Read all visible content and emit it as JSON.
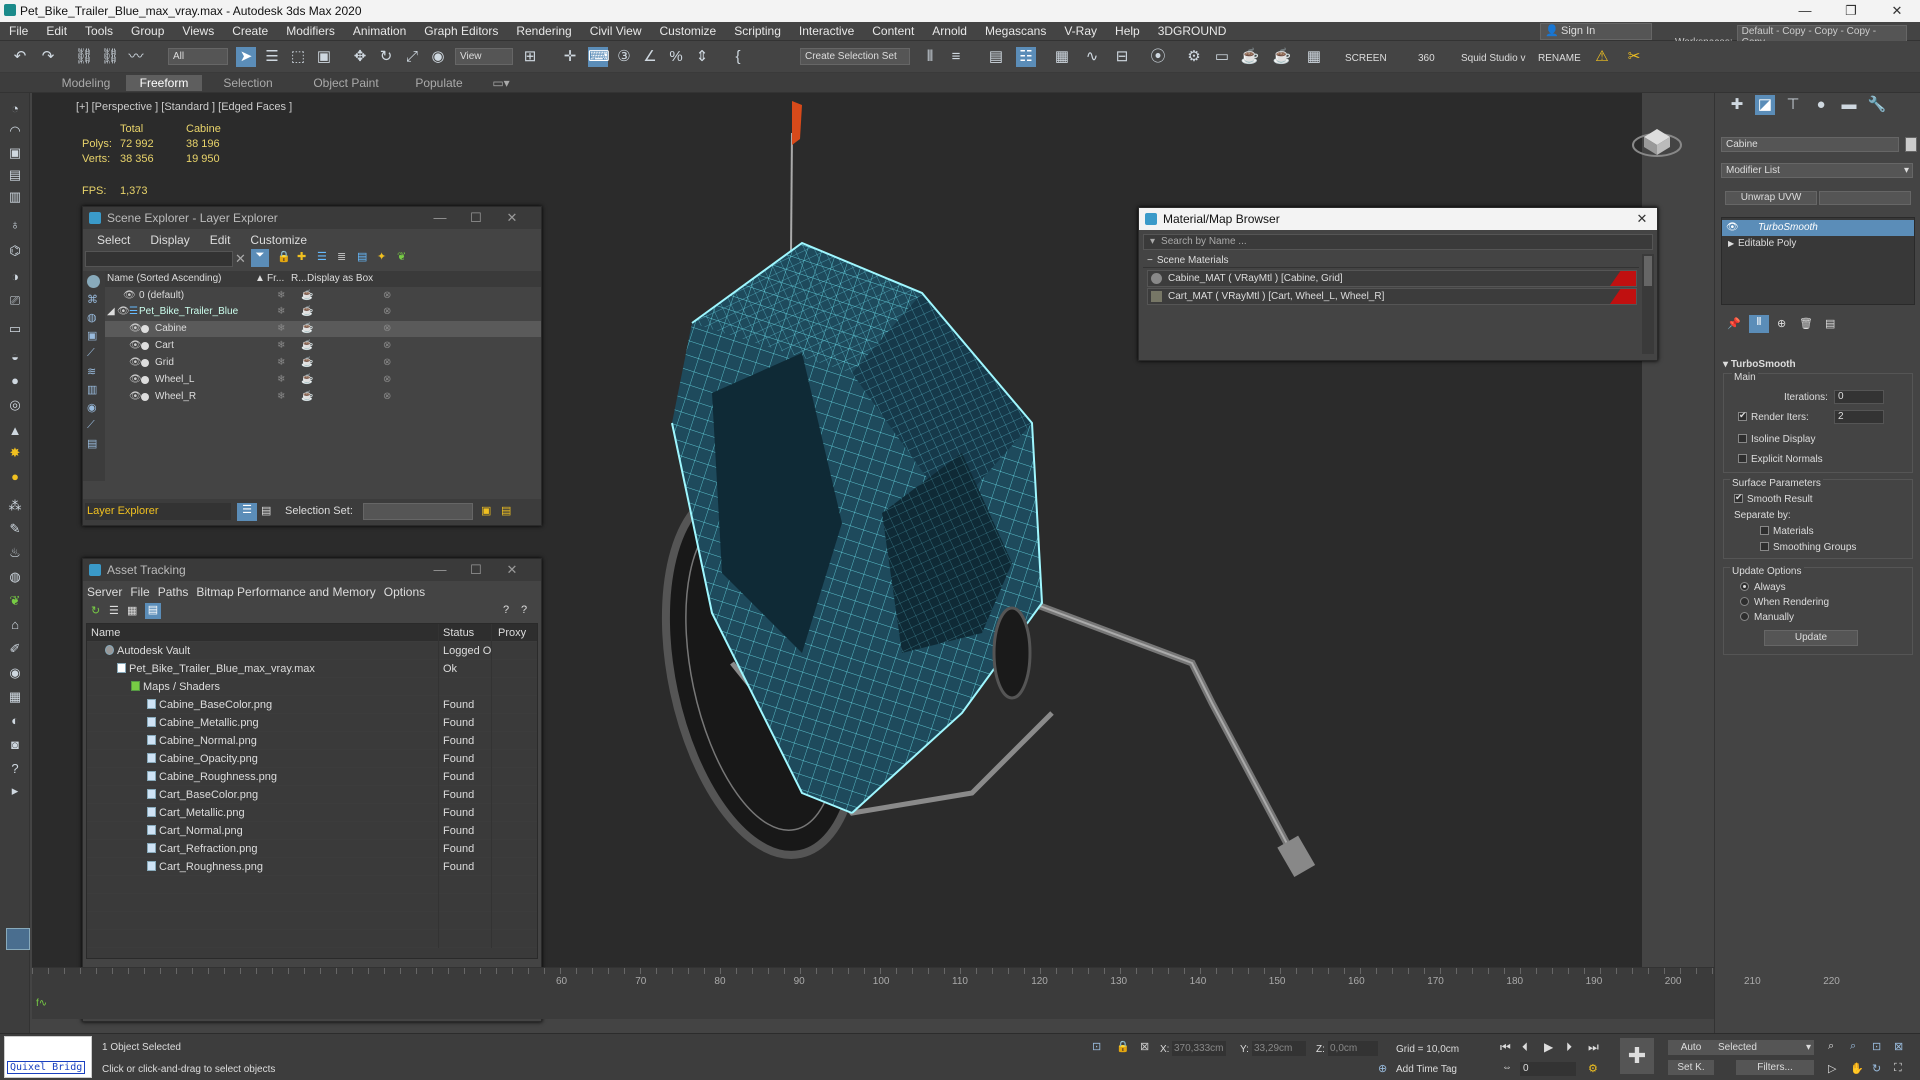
{
  "app": {
    "title": "Pet_Bike_Trailer_Blue_max_vray.max - Autodesk 3ds Max 2020"
  },
  "menu": [
    "File",
    "Edit",
    "Tools",
    "Group",
    "Views",
    "Create",
    "Modifiers",
    "Animation",
    "Graph Editors",
    "Rendering",
    "Civil View",
    "Customize",
    "Scripting",
    "Interactive",
    "Content",
    "Arnold",
    "Megascans",
    "V-Ray",
    "Help",
    "3DGROUND"
  ],
  "account": {
    "signin": "Sign In",
    "workspaces_label": "Workspaces:",
    "workspace_value": "Default - Copy - Copy - Copy - Copy"
  },
  "toolbar": {
    "filter": "All",
    "view": "View",
    "selection_set": "Create Selection Set",
    "screen": "SCREEN",
    "num360": "360",
    "squid": "Squid Studio v",
    "rename": "RENAME"
  },
  "ribbon": {
    "tabs": [
      "Modeling",
      "Freeform",
      "Selection",
      "Object Paint",
      "Populate"
    ],
    "active": "Freeform"
  },
  "viewport": {
    "label": "[+] [Perspective ] [Standard ] [Edged Faces ]",
    "stats": {
      "total_label": "Total",
      "obj_label": "Cabine",
      "polys_label": "Polys:",
      "polys_total": "72 992",
      "polys_obj": "38 196",
      "verts_label": "Verts:",
      "verts_total": "38 356",
      "verts_obj": "19 950",
      "fps_label": "FPS:",
      "fps": "1,373"
    }
  },
  "scene_explorer": {
    "title": "Scene Explorer - Layer Explorer",
    "menu": [
      "Select",
      "Display",
      "Edit",
      "Customize"
    ],
    "columns": {
      "name": "Name (Sorted Ascending)",
      "fr": "Fr...",
      "r": "R...",
      "box": "Display as Box"
    },
    "rows": [
      {
        "label": "0 (default)"
      },
      {
        "label": "Pet_Bike_Trailer_Blue"
      },
      {
        "label": "Cabine"
      },
      {
        "label": "Cart"
      },
      {
        "label": "Grid"
      },
      {
        "label": "Wheel_L"
      },
      {
        "label": "Wheel_R"
      }
    ],
    "footer_layer": "Layer Explorer",
    "footer_selset": "Selection Set:"
  },
  "asset_tracking": {
    "title": "Asset Tracking",
    "menu": [
      "Server",
      "File",
      "Paths",
      "Bitmap Performance and Memory",
      "Options"
    ],
    "columns": {
      "name": "Name",
      "status": "Status",
      "proxy": "Proxy"
    },
    "rows": [
      {
        "name": "Autodesk Vault",
        "status": "Logged O..."
      },
      {
        "name": "Pet_Bike_Trailer_Blue_max_vray.max",
        "status": "Ok"
      },
      {
        "name": "Maps / Shaders",
        "status": ""
      },
      {
        "name": "Cabine_BaseColor.png",
        "status": "Found"
      },
      {
        "name": "Cabine_Metallic.png",
        "status": "Found"
      },
      {
        "name": "Cabine_Normal.png",
        "status": "Found"
      },
      {
        "name": "Cabine_Opacity.png",
        "status": "Found"
      },
      {
        "name": "Cabine_Roughness.png",
        "status": "Found"
      },
      {
        "name": "Cart_BaseColor.png",
        "status": "Found"
      },
      {
        "name": "Cart_Metallic.png",
        "status": "Found"
      },
      {
        "name": "Cart_Normal.png",
        "status": "Found"
      },
      {
        "name": "Cart_Refraction.png",
        "status": "Found"
      },
      {
        "name": "Cart_Roughness.png",
        "status": "Found"
      }
    ]
  },
  "material_browser": {
    "title": "Material/Map Browser",
    "search_placeholder": "Search by Name ...",
    "group": "Scene Materials",
    "items": [
      {
        "label": "Cabine_MAT ( VRayMtl ) [Cabine, Grid]"
      },
      {
        "label": "Cart_MAT ( VRayMtl ) [Cart, Wheel_L, Wheel_R]"
      }
    ]
  },
  "command_panel": {
    "object_name": "Cabine",
    "modifier_list": "Modifier List",
    "unwrap": "Unwrap UVW",
    "stack": [
      "TurboSmooth",
      "Editable Poly"
    ],
    "turbosmooth": {
      "title": "TurboSmooth",
      "main": "Main",
      "iterations_label": "Iterations:",
      "iterations": "0",
      "render_iters_label": "Render Iters:",
      "render_iters": "2",
      "isoline": "Isoline Display",
      "explicit": "Explicit Normals",
      "surface": "Surface Parameters",
      "smooth_result": "Smooth Result",
      "separate_by": "Separate by:",
      "materials": "Materials",
      "smoothing_groups": "Smoothing Groups",
      "update_options": "Update Options",
      "always": "Always",
      "when_rendering": "When Rendering",
      "manually": "Manually",
      "update_btn": "Update"
    }
  },
  "timeline": {
    "ticks": [
      "60",
      "70",
      "80",
      "90",
      "100",
      "110",
      "120",
      "130",
      "140",
      "150",
      "160",
      "170",
      "180",
      "190",
      "200",
      "210",
      "220"
    ]
  },
  "status": {
    "quixel": "Quixel Bridg",
    "selected": "1 Object Selected",
    "prompt": "Click or click-and-drag to select objects",
    "x_label": "X:",
    "x_val": "370,333cm",
    "y_label": "Y:",
    "y_val": "33,29cm",
    "z_label": "Z:",
    "z_val": "0,0cm",
    "grid": "Grid = 10,0cm",
    "add_time_tag": "Add Time Tag",
    "auto": "Auto",
    "selected_dd": "Selected",
    "set_k": "Set K.",
    "filters": "Filters...",
    "frame": "0"
  },
  "colors": {
    "accent": "#5b8db8",
    "wire": "#6fe8f2",
    "cabin": "#1e4a5c"
  }
}
